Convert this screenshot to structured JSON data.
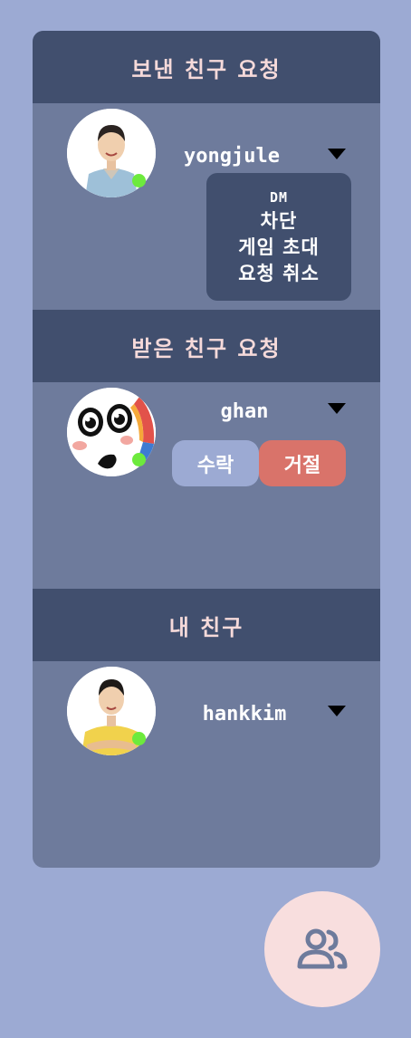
{
  "sections": {
    "sent": {
      "title": "보낸 친구 요청",
      "user": {
        "name": "yongjule",
        "online": true
      },
      "menu": [
        "DM",
        "차단",
        "게임 초대",
        "요청 취소"
      ]
    },
    "received": {
      "title": "받은 친구 요청",
      "user": {
        "name": "ghan",
        "online": true
      },
      "accept_label": "수락",
      "reject_label": "거절"
    },
    "friends": {
      "title": "내 친구",
      "user": {
        "name": "hankkim",
        "online": true
      }
    }
  },
  "icons": {
    "dropdown": "caret-down-icon",
    "fab": "friends-icon",
    "status": "online-status-dot"
  },
  "colors": {
    "background": "#9caad3",
    "panel": "#6e7b9c",
    "header": "#414f6e",
    "header_text": "#f6dada",
    "online": "#6dea3d",
    "accept": "#9caad3",
    "reject": "#d9736a",
    "fab": "#f8dede"
  }
}
